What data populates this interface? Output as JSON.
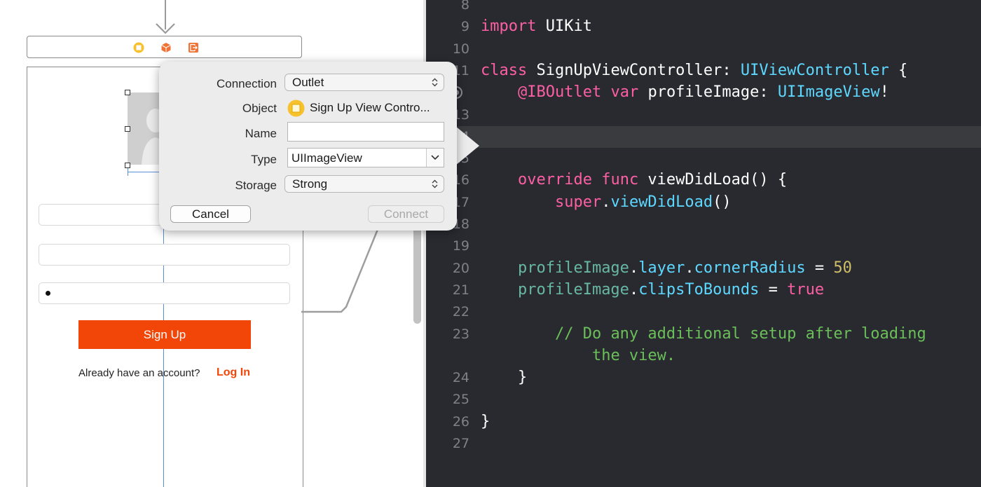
{
  "colors": {
    "editor_bg": "#292a30",
    "keyword": "#fc5fa3",
    "type": "#5dd8ff",
    "property": "#67b7a4",
    "number": "#d0bf69",
    "comment": "#6bbf59",
    "accent_orange": "#f24609"
  },
  "storyboard": {
    "dock_icons": [
      "view-controller-icon",
      "first-responder-icon",
      "exit-icon"
    ],
    "signup_button": "Sign Up",
    "already_text": "Already have an account?",
    "login_link": "Log In"
  },
  "popover": {
    "connection_label": "Connection",
    "connection_value": "Outlet",
    "object_label": "Object",
    "object_value": "Sign Up View Contro...",
    "name_label": "Name",
    "name_value": "",
    "type_label": "Type",
    "type_value": "UIImageView",
    "storage_label": "Storage",
    "storage_value": "Strong",
    "cancel_button": "Cancel",
    "connect_button": "Connect"
  },
  "code": {
    "lines": [
      {
        "n": "8",
        "tokens": []
      },
      {
        "n": "9",
        "tokens": [
          {
            "t": "import",
            "c": "kw"
          },
          {
            "t": " UIKit",
            "c": ""
          }
        ]
      },
      {
        "n": "10",
        "tokens": []
      },
      {
        "n": "11",
        "tokens": [
          {
            "t": "class",
            "c": "kw"
          },
          {
            "t": " SignUpViewController: ",
            "c": ""
          },
          {
            "t": "UIViewController",
            "c": "type"
          },
          {
            "t": " {",
            "c": ""
          }
        ]
      },
      {
        "n": "",
        "bp": true,
        "tokens": [
          {
            "t": "    ",
            "c": ""
          },
          {
            "t": "@IBOutlet",
            "c": "kw"
          },
          {
            "t": " ",
            "c": ""
          },
          {
            "t": "var",
            "c": "kw"
          },
          {
            "t": " profileImage: ",
            "c": ""
          },
          {
            "t": "UIImageView",
            "c": "type"
          },
          {
            "t": "!",
            "c": ""
          }
        ]
      },
      {
        "n": "13",
        "tokens": []
      },
      {
        "n": "14",
        "highlight": true,
        "tokens": []
      },
      {
        "n": "15",
        "tokens": []
      },
      {
        "n": "16",
        "tokens": [
          {
            "t": "    ",
            "c": ""
          },
          {
            "t": "override",
            "c": "kw"
          },
          {
            "t": " ",
            "c": ""
          },
          {
            "t": "func",
            "c": "kw"
          },
          {
            "t": " viewDidLoad() {",
            "c": ""
          }
        ]
      },
      {
        "n": "17",
        "tokens": [
          {
            "t": "        ",
            "c": ""
          },
          {
            "t": "super",
            "c": "kw"
          },
          {
            "t": ".",
            "c": ""
          },
          {
            "t": "viewDidLoad",
            "c": "type"
          },
          {
            "t": "()",
            "c": ""
          }
        ]
      },
      {
        "n": "18",
        "tokens": []
      },
      {
        "n": "19",
        "tokens": []
      },
      {
        "n": "20",
        "tokens": [
          {
            "t": "    ",
            "c": ""
          },
          {
            "t": "profileImage",
            "c": "prop"
          },
          {
            "t": ".",
            "c": ""
          },
          {
            "t": "layer",
            "c": "type"
          },
          {
            "t": ".",
            "c": ""
          },
          {
            "t": "cornerRadius",
            "c": "type"
          },
          {
            "t": " = ",
            "c": ""
          },
          {
            "t": "50",
            "c": "num"
          }
        ]
      },
      {
        "n": "21",
        "tokens": [
          {
            "t": "    ",
            "c": ""
          },
          {
            "t": "profileImage",
            "c": "prop"
          },
          {
            "t": ".",
            "c": ""
          },
          {
            "t": "clipsToBounds",
            "c": "type"
          },
          {
            "t": " = ",
            "c": ""
          },
          {
            "t": "true",
            "c": "kw"
          }
        ]
      },
      {
        "n": "22",
        "tokens": []
      },
      {
        "n": "23",
        "tokens": [
          {
            "t": "        ",
            "c": ""
          },
          {
            "t": "// Do any additional setup after loading",
            "c": "comment"
          }
        ]
      },
      {
        "n": "",
        "tokens": [
          {
            "t": "            ",
            "c": ""
          },
          {
            "t": "the view.",
            "c": "comment"
          }
        ]
      },
      {
        "n": "24",
        "tokens": [
          {
            "t": "    }",
            "c": ""
          }
        ]
      },
      {
        "n": "25",
        "tokens": []
      },
      {
        "n": "26",
        "tokens": [
          {
            "t": "}",
            "c": ""
          }
        ]
      },
      {
        "n": "27",
        "tokens": []
      }
    ]
  }
}
